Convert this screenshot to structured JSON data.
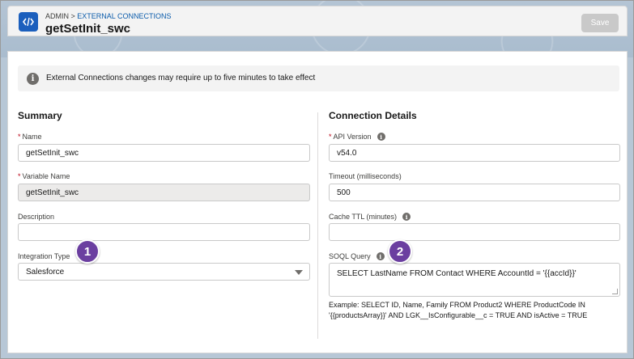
{
  "header": {
    "breadcrumb_root": "ADMIN",
    "breadcrumb_sep": ">",
    "breadcrumb_leaf": "EXTERNAL CONNECTIONS",
    "title": "getSetInit_swc",
    "icon": "code-brackets-icon",
    "save_label": "Save"
  },
  "notice": {
    "icon": "info-icon",
    "text": "External Connections changes may require up to five minutes to take effect"
  },
  "summary": {
    "title": "Summary",
    "name_label": "Name",
    "name_value": "getSetInit_swc",
    "variable_label": "Variable Name",
    "variable_value": "getSetInit_swc",
    "description_label": "Description",
    "description_value": "",
    "integration_label": "Integration Type",
    "integration_value": "Salesforce"
  },
  "connection": {
    "title": "Connection Details",
    "api_label": "API Version",
    "api_value": "v54.0",
    "timeout_label": "Timeout (milliseconds)",
    "timeout_value": "500",
    "cache_label": "Cache TTL (minutes)",
    "cache_value": "",
    "soql_label": "SOQL Query",
    "soql_value": "SELECT LastName FROM Contact WHERE AccountId = '{{accId}}'",
    "example_text": "Example: SELECT ID, Name, Family FROM Product2 WHERE ProductCode IN '{{productsArray}}' AND LGK__IsConfigurable__c = TRUE AND isActive = TRUE"
  },
  "callouts": {
    "one": "1",
    "two": "2",
    "color": "#6b3fa0"
  },
  "colors": {
    "brand": "#1b5fbd",
    "link": "#0b5cab",
    "required": "#ba0517"
  }
}
